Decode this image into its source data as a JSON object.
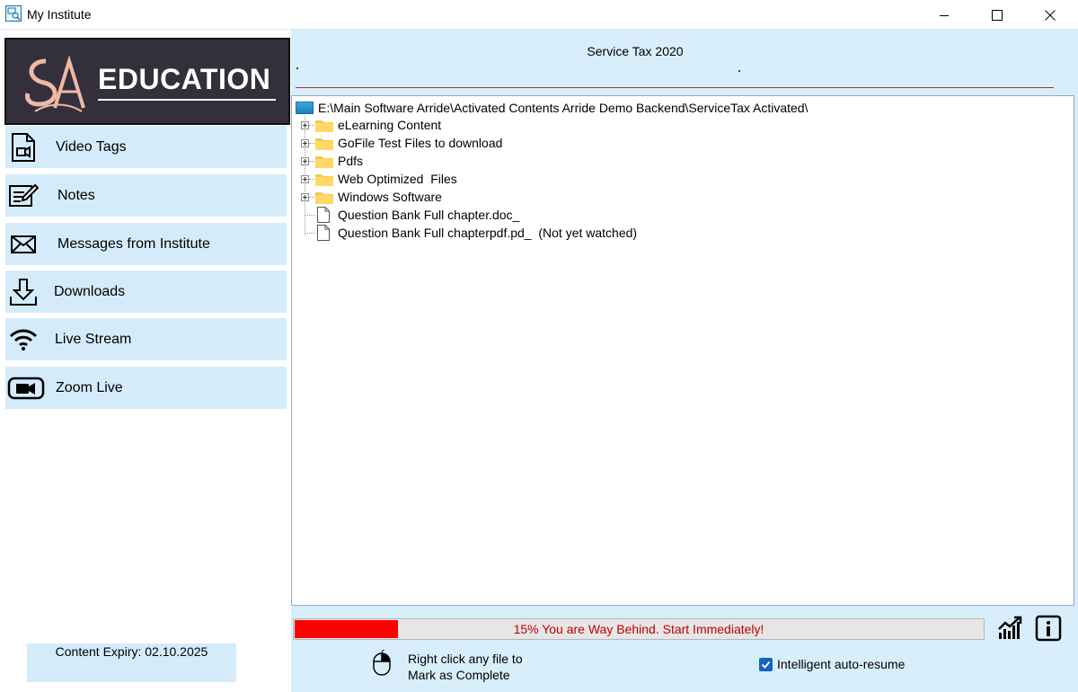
{
  "window": {
    "title": "My Institute",
    "controls": [
      "minimize-icon",
      "maximize-icon",
      "close-icon"
    ]
  },
  "sidebar": {
    "logo_text": "EDUCATION",
    "logo_monogram": "SA",
    "items": [
      {
        "label": "Video Tags",
        "icon": "video-file-icon"
      },
      {
        "label": "Notes",
        "icon": "notes-pen-icon"
      },
      {
        "label": "Messages from Institute",
        "icon": "envelope-icon"
      },
      {
        "label": "Downloads",
        "icon": "download-icon"
      },
      {
        "label": "Live Stream",
        "icon": "wifi-icon"
      },
      {
        "label": "Zoom Live",
        "icon": "video-camera-icon"
      }
    ],
    "expiry": "Content Expiry: 02.10.2025"
  },
  "content": {
    "title": "Service Tax 2020",
    "tree": {
      "root": "E:\\Main Software Arride\\Activated Contents Arride Demo Backend\\ServiceTax Activated\\",
      "folders": [
        "eLearning Content",
        "GoFile Test Files to download",
        "Pdfs",
        "Web Optimized  Files",
        "Windows Software"
      ],
      "files": [
        "Question Bank Full chapter.doc_",
        "Question Bank Full chapterpdf.pd_  (Not yet watched)"
      ]
    },
    "progress": {
      "percent": 15,
      "text": "15% You are Way Behind. Start Immediately!",
      "color": "#ff0000"
    },
    "hint_line1": "Right click any file to",
    "hint_line2": "Mark as Complete",
    "auto_resume_label": "Intelligent auto-resume",
    "auto_resume_checked": true,
    "tool_icons": [
      "chart-growth-icon",
      "info-icon"
    ]
  }
}
